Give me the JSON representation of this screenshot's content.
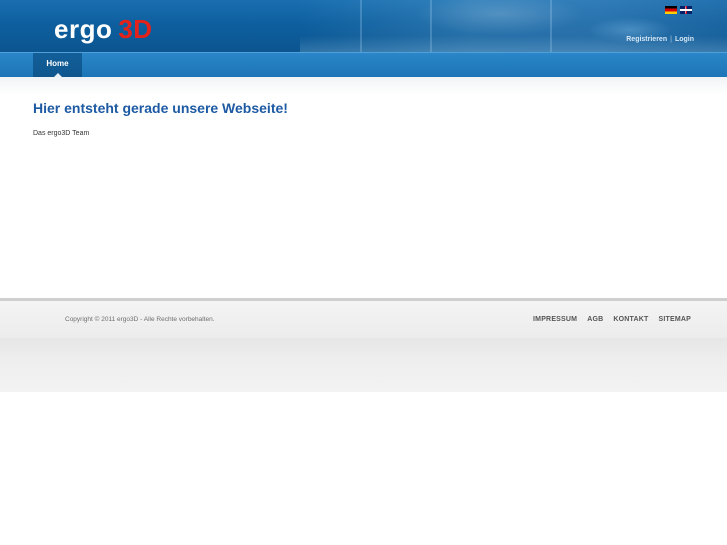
{
  "header": {
    "logo": {
      "part1": "ergo",
      "part2": "3D"
    },
    "languages": [
      {
        "code": "de",
        "icon": "flag-germany-icon"
      },
      {
        "code": "en",
        "icon": "flag-uk-icon"
      }
    ],
    "user_links": {
      "register": "Registrieren",
      "separator": "|",
      "login": "Login"
    }
  },
  "nav": {
    "tabs": [
      {
        "label": "Home",
        "active": true
      }
    ]
  },
  "main": {
    "title": "Hier entsteht gerade unsere Webseite!",
    "text": "Das ergo3D Team"
  },
  "footer": {
    "copyright": "Copyright © 2011 ergo3D - Alle Rechte vorbehalten.",
    "links": [
      "IMPRESSUM",
      "AGB",
      "KONTAKT",
      "SITEMAP"
    ]
  },
  "colors": {
    "header_blue": "#0e5f9f",
    "nav_blue": "#1c75b6",
    "logo_red": "#e3231b",
    "title_blue": "#1d5aa3"
  }
}
